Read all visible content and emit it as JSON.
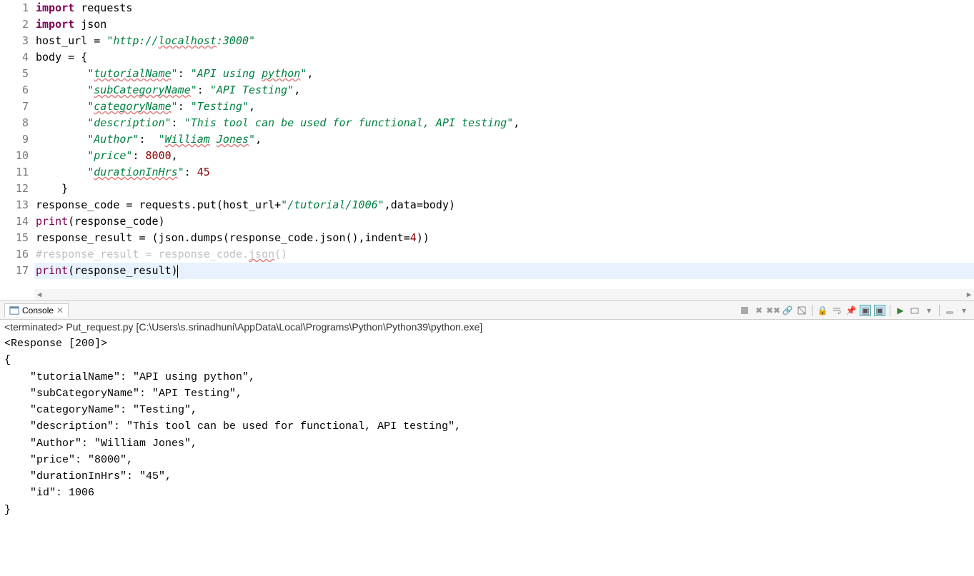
{
  "code": {
    "lines": [
      {
        "n": 1,
        "fold": "⊖",
        "tokens": [
          {
            "t": "import",
            "c": "kw"
          },
          {
            "t": " requests",
            "c": ""
          }
        ]
      },
      {
        "n": 2,
        "tokens": [
          {
            "t": "import",
            "c": "kw"
          },
          {
            "t": " json",
            "c": ""
          }
        ]
      },
      {
        "n": 3,
        "tokens": [
          {
            "t": "host_url = ",
            "c": ""
          },
          {
            "t": "\"http://",
            "c": "str"
          },
          {
            "t": "localhost",
            "c": "str squiggle"
          },
          {
            "t": ":3000\"",
            "c": "str"
          }
        ]
      },
      {
        "n": 4,
        "tokens": [
          {
            "t": "body = {",
            "c": ""
          }
        ]
      },
      {
        "n": 5,
        "tokens": [
          {
            "t": "        ",
            "c": ""
          },
          {
            "t": "\"",
            "c": "str"
          },
          {
            "t": "tutorialName",
            "c": "str squiggle"
          },
          {
            "t": "\"",
            "c": "str"
          },
          {
            "t": ": ",
            "c": ""
          },
          {
            "t": "\"API using ",
            "c": "str"
          },
          {
            "t": "python",
            "c": "str squiggle"
          },
          {
            "t": "\"",
            "c": "str"
          },
          {
            "t": ",",
            "c": ""
          }
        ]
      },
      {
        "n": 6,
        "tokens": [
          {
            "t": "        ",
            "c": ""
          },
          {
            "t": "\"",
            "c": "str"
          },
          {
            "t": "subCategoryName",
            "c": "str squiggle"
          },
          {
            "t": "\"",
            "c": "str"
          },
          {
            "t": ": ",
            "c": ""
          },
          {
            "t": "\"API Testing\"",
            "c": "str"
          },
          {
            "t": ",",
            "c": ""
          }
        ]
      },
      {
        "n": 7,
        "tokens": [
          {
            "t": "        ",
            "c": ""
          },
          {
            "t": "\"",
            "c": "str"
          },
          {
            "t": "categoryName",
            "c": "str squiggle"
          },
          {
            "t": "\"",
            "c": "str"
          },
          {
            "t": ": ",
            "c": ""
          },
          {
            "t": "\"Testing\"",
            "c": "str"
          },
          {
            "t": ",",
            "c": ""
          }
        ]
      },
      {
        "n": 8,
        "tokens": [
          {
            "t": "        ",
            "c": ""
          },
          {
            "t": "\"description\"",
            "c": "str"
          },
          {
            "t": ": ",
            "c": ""
          },
          {
            "t": "\"This tool can be used for functional, API testing\"",
            "c": "str"
          },
          {
            "t": ",",
            "c": ""
          }
        ]
      },
      {
        "n": 9,
        "tokens": [
          {
            "t": "        ",
            "c": ""
          },
          {
            "t": "\"Author\"",
            "c": "str"
          },
          {
            "t": ":  ",
            "c": ""
          },
          {
            "t": "\"",
            "c": "str"
          },
          {
            "t": "William",
            "c": "str squiggle"
          },
          {
            "t": " ",
            "c": "str"
          },
          {
            "t": "Jones",
            "c": "str squiggle"
          },
          {
            "t": "\"",
            "c": "str"
          },
          {
            "t": ",",
            "c": ""
          }
        ]
      },
      {
        "n": 10,
        "tokens": [
          {
            "t": "        ",
            "c": ""
          },
          {
            "t": "\"price\"",
            "c": "str"
          },
          {
            "t": ": ",
            "c": ""
          },
          {
            "t": "8000",
            "c": "num"
          },
          {
            "t": ",",
            "c": ""
          }
        ]
      },
      {
        "n": 11,
        "tokens": [
          {
            "t": "        ",
            "c": ""
          },
          {
            "t": "\"",
            "c": "str"
          },
          {
            "t": "durationInHrs",
            "c": "str squiggle"
          },
          {
            "t": "\"",
            "c": "str"
          },
          {
            "t": ": ",
            "c": ""
          },
          {
            "t": "45",
            "c": "num"
          }
        ]
      },
      {
        "n": 12,
        "tokens": [
          {
            "t": "    }",
            "c": ""
          }
        ]
      },
      {
        "n": 13,
        "tokens": [
          {
            "t": "response_code = requests.put(host_url+",
            "c": ""
          },
          {
            "t": "\"/tutorial/1006\"",
            "c": "str"
          },
          {
            "t": ",data=body)",
            "c": ""
          }
        ]
      },
      {
        "n": 14,
        "tokens": [
          {
            "t": "print",
            "c": "bif"
          },
          {
            "t": "(response_code)",
            "c": ""
          }
        ]
      },
      {
        "n": 15,
        "tokens": [
          {
            "t": "response_result = (json.dumps(response_code.json(),indent=",
            "c": ""
          },
          {
            "t": "4",
            "c": "num"
          },
          {
            "t": "))",
            "c": ""
          }
        ]
      },
      {
        "n": 16,
        "tokens": [
          {
            "t": "#response_result = response_code.",
            "c": "comment"
          },
          {
            "t": "json",
            "c": "comment squiggle"
          },
          {
            "t": "()",
            "c": "comment"
          }
        ]
      },
      {
        "n": 17,
        "current": true,
        "tokens": [
          {
            "t": "print",
            "c": "bif"
          },
          {
            "t": "(response_result)",
            "c": ""
          }
        ],
        "cursor": true
      }
    ]
  },
  "console": {
    "tab_label": "Console",
    "status": "<terminated> Put_request.py [C:\\Users\\s.srinadhuni\\AppData\\Local\\Programs\\Python\\Python39\\python.exe]",
    "output": "<Response [200]>\n{\n    \"tutorialName\": \"API using python\",\n    \"subCategoryName\": \"API Testing\",\n    \"categoryName\": \"Testing\",\n    \"description\": \"This tool can be used for functional, API testing\",\n    \"Author\": \"William Jones\",\n    \"price\": \"8000\",\n    \"durationInHrs\": \"45\",\n    \"id\": 1006\n}"
  }
}
